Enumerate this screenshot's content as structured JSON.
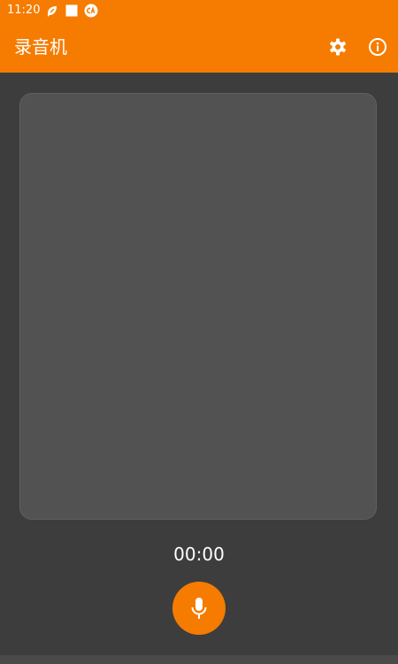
{
  "status_bar": {
    "time": "11:20",
    "icons": [
      "notification-leaf-icon",
      "notification-square-icon",
      "notification-ca-icon"
    ]
  },
  "app_bar": {
    "title": "录音机",
    "actions": [
      "settings-icon",
      "info-icon"
    ]
  },
  "recorder": {
    "timer": "00:00",
    "record_button_icon": "microphone-icon"
  },
  "colors": {
    "accent": "#f57c00",
    "background": "#3d3d3d",
    "panel": "#525252",
    "text": "#ffffff"
  }
}
